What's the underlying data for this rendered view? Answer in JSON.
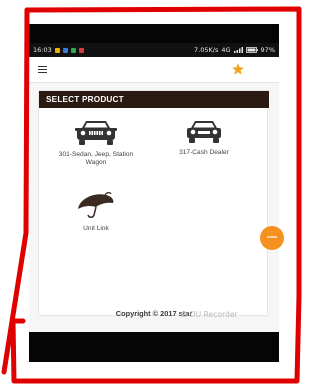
{
  "status_bar": {
    "time": "16:03",
    "speed": "7.05K/s",
    "network": "4G",
    "battery": "97%"
  },
  "header": {
    "menu_icon": "hamburger-icon",
    "logo_icon": "star-logo-icon"
  },
  "card": {
    "title": "SELECT PRODUCT"
  },
  "products": [
    {
      "label": "301-Sedan, Jeep, Station Wagon",
      "icon": "car-front-icon"
    },
    {
      "label": "317-Cash Dealer",
      "icon": "car-front-icon"
    },
    {
      "label": "Unit Link",
      "icon": "umbrella-icon"
    }
  ],
  "fab": {
    "icon": "floating-action-icon"
  },
  "footer": {
    "copyright": "Copyright © 2017 star"
  },
  "watermark": "⊡ DU Recorder",
  "colors": {
    "title_bar": "#2b1a12",
    "fab": "#f4911f",
    "annotation": "#e00000"
  }
}
